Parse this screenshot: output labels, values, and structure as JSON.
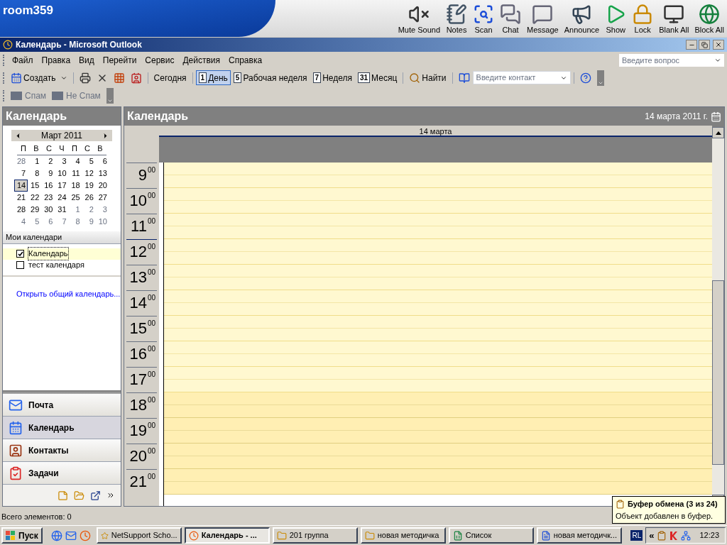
{
  "netsupport": {
    "computer": "room359",
    "tools": [
      {
        "label": "Mute Sound"
      },
      {
        "label": "Notes"
      },
      {
        "label": "Scan"
      },
      {
        "label": "Chat"
      },
      {
        "label": "Message"
      },
      {
        "label": "Announce"
      },
      {
        "label": "Show"
      },
      {
        "label": "Lock"
      },
      {
        "label": "Blank All"
      },
      {
        "label": "Block All"
      }
    ]
  },
  "window": {
    "title": "Календарь - Microsoft Outlook"
  },
  "menu": [
    "Файл",
    "Правка",
    "Вид",
    "Перейти",
    "Сервис",
    "Действия",
    "Справка"
  ],
  "help_search": {
    "placeholder": "Введите вопрос"
  },
  "toolbar": [
    {
      "kind": "button",
      "label": "Создать",
      "selected": false
    },
    {
      "kind": "sep"
    },
    {
      "kind": "button",
      "selected": false
    },
    {
      "kind": "button",
      "selected": false
    },
    {
      "kind": "button",
      "selected": false
    },
    {
      "kind": "button",
      "selected": false
    },
    {
      "kind": "sep"
    },
    {
      "kind": "button",
      "label": "Сегодня",
      "selected": false
    },
    {
      "kind": "sep"
    },
    {
      "kind": "button",
      "label": "День",
      "badge": "1",
      "selected": true
    },
    {
      "kind": "button",
      "label": "Рабочая неделя",
      "badge": "5",
      "selected": false
    },
    {
      "kind": "button",
      "label": "Неделя",
      "badge": "7",
      "selected": false
    },
    {
      "kind": "button",
      "label": "Месяц",
      "badge": "31",
      "selected": false
    },
    {
      "kind": "sep"
    },
    {
      "kind": "button",
      "label": "Найти",
      "selected": false
    },
    {
      "kind": "sep"
    },
    {
      "kind": "button",
      "selected": false
    },
    {
      "kind": "field",
      "placeholder": "Введите контакт"
    },
    {
      "kind": "sep"
    },
    {
      "kind": "button",
      "selected": false
    }
  ],
  "spam_toolbar": [
    {
      "label": "Спам",
      "disabled": true
    },
    {
      "label": "Не Спам",
      "disabled": true
    }
  ],
  "nav_pane": {
    "title": "Календарь",
    "mini_calendar": {
      "month": "Март 2011",
      "weekdays": [
        "П",
        "В",
        "С",
        "Ч",
        "П",
        "С",
        "В"
      ],
      "weeks": [
        [
          {
            "d": "28",
            "other": true,
            "selected": false
          },
          {
            "d": "1",
            "other": false,
            "selected": false
          },
          {
            "d": "2",
            "other": false,
            "selected": false
          },
          {
            "d": "3",
            "other": false,
            "selected": false
          },
          {
            "d": "4",
            "other": false,
            "selected": false
          },
          {
            "d": "5",
            "other": false,
            "selected": false
          },
          {
            "d": "6",
            "other": false,
            "selected": false
          }
        ],
        [
          {
            "d": "7",
            "other": false,
            "selected": false
          },
          {
            "d": "8",
            "other": false,
            "selected": false
          },
          {
            "d": "9",
            "other": false,
            "selected": false
          },
          {
            "d": "10",
            "other": false,
            "selected": false
          },
          {
            "d": "11",
            "other": false,
            "selected": false
          },
          {
            "d": "12",
            "other": false,
            "selected": false
          },
          {
            "d": "13",
            "other": false,
            "selected": false
          }
        ],
        [
          {
            "d": "14",
            "other": false,
            "selected": true
          },
          {
            "d": "15",
            "other": false,
            "selected": false
          },
          {
            "d": "16",
            "other": false,
            "selected": false
          },
          {
            "d": "17",
            "other": false,
            "selected": false
          },
          {
            "d": "18",
            "other": false,
            "selected": false
          },
          {
            "d": "19",
            "other": false,
            "selected": false
          },
          {
            "d": "20",
            "other": false,
            "selected": false
          }
        ],
        [
          {
            "d": "21",
            "other": false,
            "selected": false
          },
          {
            "d": "22",
            "other": false,
            "selected": false
          },
          {
            "d": "23",
            "other": false,
            "selected": false
          },
          {
            "d": "24",
            "other": false,
            "selected": false
          },
          {
            "d": "25",
            "other": false,
            "selected": false
          },
          {
            "d": "26",
            "other": false,
            "selected": false
          },
          {
            "d": "27",
            "other": false,
            "selected": false
          }
        ],
        [
          {
            "d": "28",
            "other": false,
            "selected": false
          },
          {
            "d": "29",
            "other": false,
            "selected": false
          },
          {
            "d": "30",
            "other": false,
            "selected": false
          },
          {
            "d": "31",
            "other": false,
            "selected": false
          },
          {
            "d": "1",
            "other": true,
            "selected": false
          },
          {
            "d": "2",
            "other": true,
            "selected": false
          },
          {
            "d": "3",
            "other": true,
            "selected": false
          }
        ],
        [
          {
            "d": "4",
            "other": true,
            "selected": false
          },
          {
            "d": "5",
            "other": true,
            "selected": false
          },
          {
            "d": "6",
            "other": true,
            "selected": false
          },
          {
            "d": "7",
            "other": true,
            "selected": false
          },
          {
            "d": "8",
            "other": true,
            "selected": false
          },
          {
            "d": "9",
            "other": true,
            "selected": false
          },
          {
            "d": "10",
            "other": true,
            "selected": false
          }
        ]
      ]
    },
    "my_calendars": {
      "title": "Мои календари",
      "items": [
        {
          "label": "Календарь",
          "checked": true,
          "selected": true
        },
        {
          "label": "тест календаря",
          "checked": false,
          "selected": false
        }
      ]
    },
    "link": "Открыть общий календарь...",
    "sections": [
      {
        "label": "Почта",
        "selected": false
      },
      {
        "label": "Календарь",
        "selected": true
      },
      {
        "label": "Контакты",
        "selected": false
      },
      {
        "label": "Задачи",
        "selected": false
      }
    ]
  },
  "calendar": {
    "title": "Календарь",
    "date": "14 марта 2011 г.",
    "day_header": "14 марта",
    "hours": [
      {
        "h": "9",
        "m": "00",
        "work": true,
        "now": false
      },
      {
        "h": "10",
        "m": "00",
        "work": true,
        "now": false
      },
      {
        "h": "11",
        "m": "00",
        "work": true,
        "now": false
      },
      {
        "h": "12",
        "m": "00",
        "work": true,
        "now": true
      },
      {
        "h": "13",
        "m": "00",
        "work": true,
        "now": false
      },
      {
        "h": "14",
        "m": "00",
        "work": true,
        "now": false
      },
      {
        "h": "15",
        "m": "00",
        "work": true,
        "now": false
      },
      {
        "h": "16",
        "m": "00",
        "work": true,
        "now": false
      },
      {
        "h": "17",
        "m": "00",
        "work": true,
        "now": false
      },
      {
        "h": "18",
        "m": "00",
        "work": false,
        "now": false
      },
      {
        "h": "19",
        "m": "00",
        "work": false,
        "now": false
      },
      {
        "h": "20",
        "m": "00",
        "work": false,
        "now": false
      },
      {
        "h": "21",
        "m": "00",
        "work": false,
        "now": false
      }
    ]
  },
  "status_bar": "Всего элементов: 0",
  "balloon": {
    "title": "Буфер обмена (3 из 24)",
    "text": "Объект добавлен в буфер."
  },
  "taskbar": {
    "start": "Пуск",
    "buttons": [
      {
        "label": "NetSupport Scho...",
        "selected": false
      },
      {
        "label": "Календарь - ...",
        "selected": true
      },
      {
        "label": "201 группа",
        "selected": false
      },
      {
        "label": "новая методичка",
        "selected": false
      },
      {
        "label": "Список",
        "selected": false
      },
      {
        "label": "новая методичк...",
        "selected": false
      }
    ],
    "tray_lang": "RL",
    "tray_expand": "«",
    "clock": "12:23"
  }
}
